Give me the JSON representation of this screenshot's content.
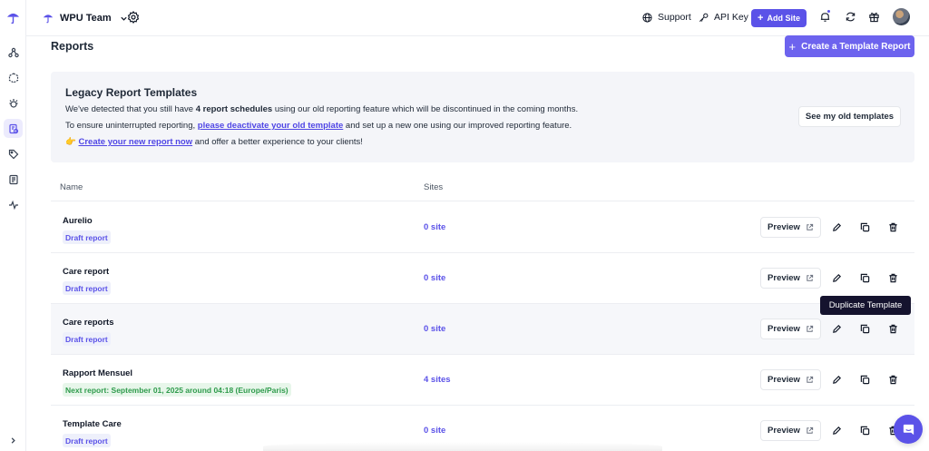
{
  "header": {
    "team_name": "WPU Team",
    "support_label": "Support",
    "api_key_label": "API Key",
    "add_site_label": "Add Site"
  },
  "sidebar": {
    "items": [
      {
        "icon": "sites-network-icon"
      },
      {
        "icon": "cube-icon"
      },
      {
        "icon": "bug-icon"
      },
      {
        "icon": "reports-icon",
        "active": true
      },
      {
        "icon": "tag-icon"
      },
      {
        "icon": "document-icon"
      },
      {
        "icon": "activity-icon"
      }
    ]
  },
  "page": {
    "title": "Reports",
    "create_button_label": "Create a Template Report"
  },
  "banner": {
    "title": "Legacy Report Templates",
    "line1_pre": "We've detected that you still have ",
    "line1_bold": "4 report schedules",
    "line1_post": " using our old reporting feature which will be discontinued in the coming months.",
    "line2_pre": "To ensure uninterrupted reporting, ",
    "line2_link": "please deactivate your old template",
    "line2_post": " and set up a new one using our improved reporting feature.",
    "line3_emoji": "👉",
    "line3_link": "Create your new report now",
    "line3_post": " and offer a better experience to your clients!",
    "old_templates_button": "See my old templates"
  },
  "table": {
    "columns": [
      "Name",
      "Sites"
    ],
    "rows": [
      {
        "name": "Aurelio",
        "badge": "Draft report",
        "badge_type": "draft",
        "sites": "0 site"
      },
      {
        "name": "Care report",
        "badge": "Draft report",
        "badge_type": "draft",
        "sites": "0 site"
      },
      {
        "name": "Care reports",
        "badge": "Draft report",
        "badge_type": "draft",
        "sites": "0 site"
      },
      {
        "name": "Rapport Mensuel",
        "badge": "Next report: September 01, 2025 around 04:18 (Europe/Paris)",
        "badge_type": "next",
        "sites": "4 sites"
      },
      {
        "name": "Template Care",
        "badge": "Draft report",
        "badge_type": "draft",
        "sites": "0 site"
      }
    ],
    "preview_label": "Preview"
  },
  "tooltip": "Duplicate Template",
  "colors": {
    "accent": "#5b52e8",
    "tooltip_bg": "#15132e",
    "banner_bg": "#f4f5f9",
    "next_badge": "#2f9b4c"
  }
}
